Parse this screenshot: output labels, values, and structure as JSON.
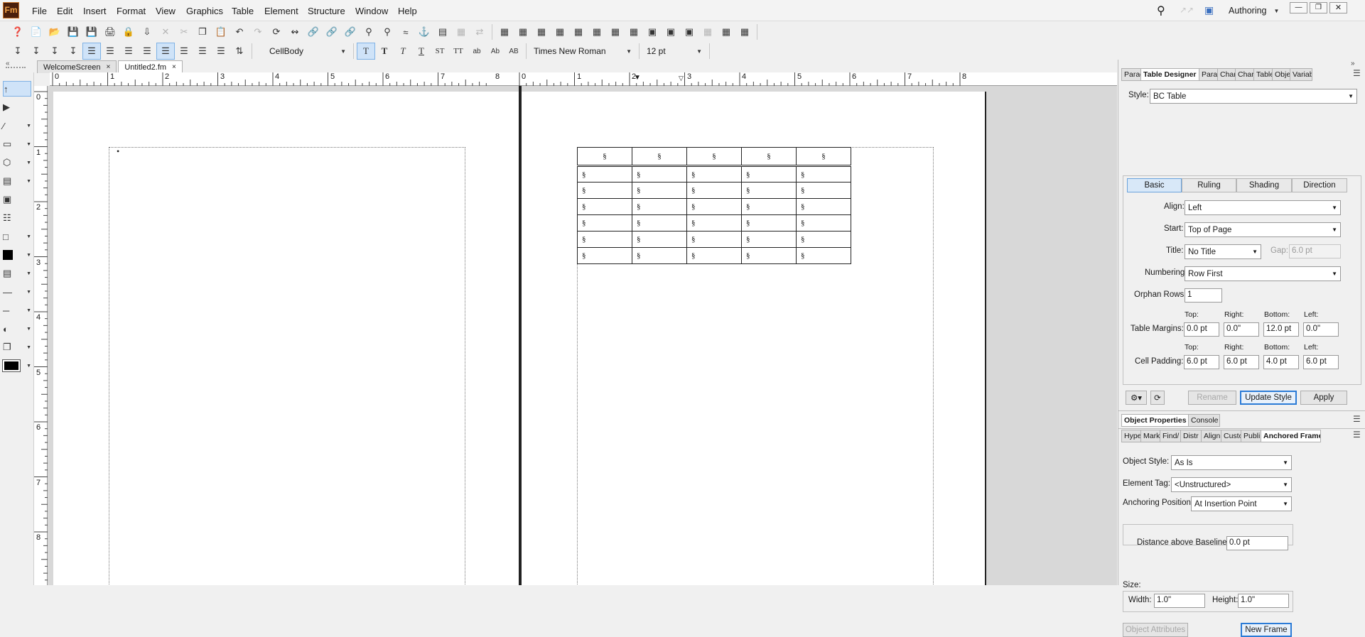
{
  "app": {
    "logo": "Fm",
    "workspace": "Authoring"
  },
  "menu": [
    "File",
    "Edit",
    "Insert",
    "Format",
    "View",
    "Graphics",
    "Table",
    "Element",
    "Structure",
    "Window",
    "Help"
  ],
  "format_bar": {
    "paragraph_tag": "CellBody",
    "font": "Times New Roman",
    "size": "12 pt"
  },
  "doc_tabs": [
    {
      "label": "WelcomeScreen",
      "close": "×"
    },
    {
      "label": "Untitled2.fm",
      "close": "×"
    }
  ],
  "ruler": {
    "left_numbers": [
      "0",
      "1",
      "2",
      "3",
      "4",
      "5",
      "6",
      "7",
      "8"
    ],
    "right_numbers": [
      "0",
      "1",
      "2",
      "3",
      "4",
      "5",
      "6",
      "7",
      "8"
    ],
    "vertical_numbers": [
      "0",
      "1",
      "2",
      "3",
      "4",
      "5",
      "6",
      "7",
      "8"
    ]
  },
  "table": {
    "header": [
      "§",
      "§",
      "§",
      "§",
      "§"
    ],
    "rows": [
      [
        "§",
        "§",
        "§",
        "§",
        "§"
      ],
      [
        "§",
        "§",
        "§",
        "§",
        "§"
      ],
      [
        "§",
        "§",
        "§",
        "§",
        "§"
      ],
      [
        "§",
        "§",
        "§",
        "§",
        "§"
      ],
      [
        "§",
        "§",
        "§",
        "§",
        "§"
      ],
      [
        "§",
        "§",
        "§",
        "§",
        "§"
      ]
    ]
  },
  "table_designer": {
    "tabs": [
      "Parag",
      "Table Designer",
      "Parag",
      "Chara",
      "Chara",
      "Table",
      "Obje",
      "Variab"
    ],
    "style_label": "Style:",
    "style_value": "BC Table",
    "sub_tabs": [
      "Basic",
      "Ruling",
      "Shading",
      "Direction"
    ],
    "align_label": "Align:",
    "align_value": "Left",
    "start_label": "Start:",
    "start_value": "Top of Page",
    "title_label": "Title:",
    "title_value": "No Title",
    "gap_label": "Gap:",
    "gap_value": "6.0 pt",
    "numbering_label": "Numbering:",
    "numbering_value": "Row First",
    "orphan_label": "Orphan Rows:",
    "orphan_value": "1",
    "margins_label": "Table Margins:",
    "padding_label": "Cell Padding:",
    "col_top": "Top:",
    "col_right": "Right:",
    "col_bottom": "Bottom:",
    "col_left": "Left:",
    "margins": {
      "top": "0.0 pt",
      "right": "0.0\"",
      "bottom": "12.0 pt",
      "left": "0.0\""
    },
    "padding": {
      "top": "6.0 pt",
      "right": "6.0 pt",
      "bottom": "4.0 pt",
      "left": "6.0 pt"
    },
    "rename": "Rename",
    "update_style": "Update Style",
    "apply": "Apply"
  },
  "mid_tabs": [
    "Object Properties",
    "Console"
  ],
  "object_tabs": [
    "Hype",
    "Mark",
    "Find/",
    "Distr",
    "Align",
    "Custo",
    "Publi",
    "Anchored Frame"
  ],
  "anchored_frame": {
    "object_style_label": "Object Style:",
    "object_style_value": "As Is",
    "element_tag_label": "Element Tag:",
    "element_tag_value": "<Unstructured>",
    "anchoring_label": "Anchoring Position:",
    "anchoring_value": "At Insertion Point",
    "distance_label": "Distance above Baseline:",
    "distance_value": "0.0 pt",
    "size_label": "Size:",
    "width_label": "Width:",
    "width_value": "1.0\"",
    "height_label": "Height:",
    "height_value": "1.0\"",
    "object_attributes": "Object Attributes",
    "new_frame": "New Frame"
  }
}
